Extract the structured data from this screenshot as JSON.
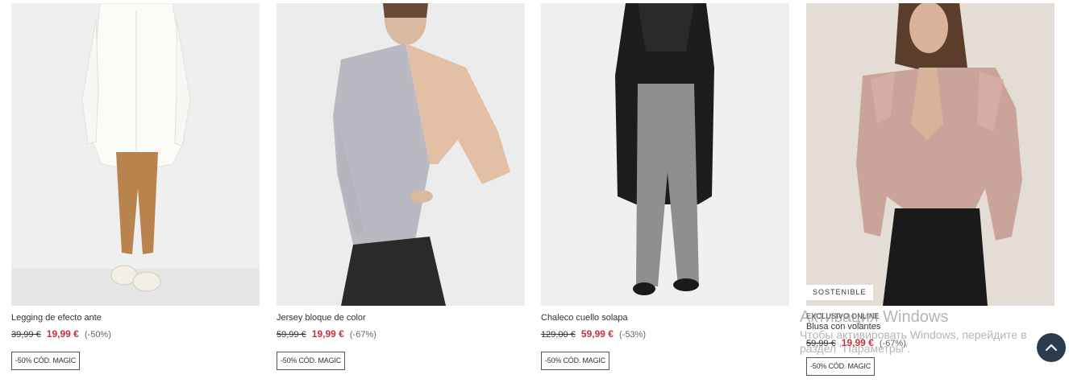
{
  "products": [
    {
      "name": "Legging de efecto ante",
      "old_price": "39,99 €",
      "new_price": "19,99 €",
      "discount": "(-50%)",
      "promo": "-50% CÓD. MAGIC",
      "image": "model-white-shirt-brown-leggings"
    },
    {
      "name": "Jersey bloque de color",
      "old_price": "59,99 €",
      "new_price": "19,99 €",
      "discount": "(-67%)",
      "promo": "-50% CÓD. MAGIC",
      "image": "model-grey-peach-sweater"
    },
    {
      "name": "Chaleco cuello solapa",
      "old_price": "129,00 €",
      "new_price": "59,99 €",
      "discount": "(-53%)",
      "promo": "-50% CÓD. MAGIC",
      "image": "model-black-long-vest"
    },
    {
      "badge": "SOSTENIBLE",
      "exclusive": "EXCLUSIVO ONLINE",
      "name": "Blusa con volantes",
      "old_price": "59,99 €",
      "new_price": "19,99 €",
      "discount": "(-67%)",
      "promo": "-50% CÓD. MAGIC",
      "image": "model-pink-ruffle-blouse"
    }
  ],
  "watermark": {
    "title": "Активация Windows",
    "text": "Чтобы активировать Windows, перейдите в раздел \"Параметры\"."
  },
  "scroll_top_icon": "chevron-up-icon",
  "colors": {
    "sale_red": "#c8323c",
    "scroll_button": "#2c3c4c"
  }
}
